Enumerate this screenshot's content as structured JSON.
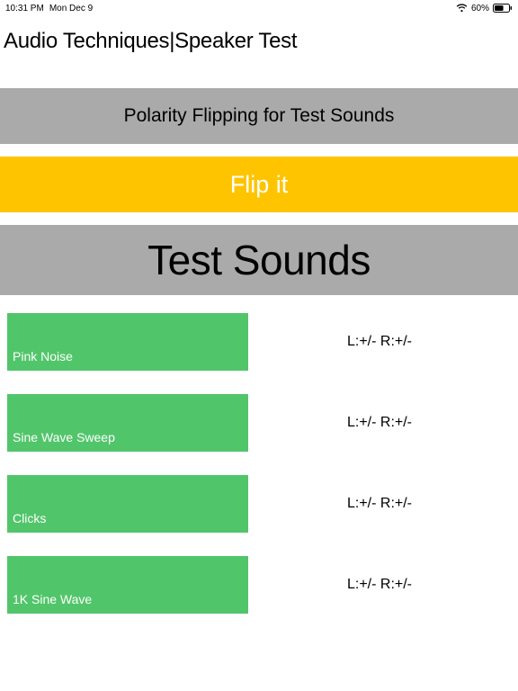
{
  "status_bar": {
    "time": "10:31 PM",
    "date": "Mon Dec 9",
    "battery_pct": "60%"
  },
  "page_title": "Audio Techniques|Speaker Test",
  "polarity_banner": "Polarity Flipping for Test Sounds",
  "flip_button_label": "Flip it",
  "test_sounds_header": "Test Sounds",
  "sounds": [
    {
      "label": "Pink Noise",
      "status": "L:+/- R:+/-"
    },
    {
      "label": "Sine Wave Sweep",
      "status": "L:+/- R:+/-"
    },
    {
      "label": "Clicks",
      "status": "L:+/- R:+/-"
    },
    {
      "label": "1K Sine Wave",
      "status": "L:+/- R:+/-"
    }
  ]
}
